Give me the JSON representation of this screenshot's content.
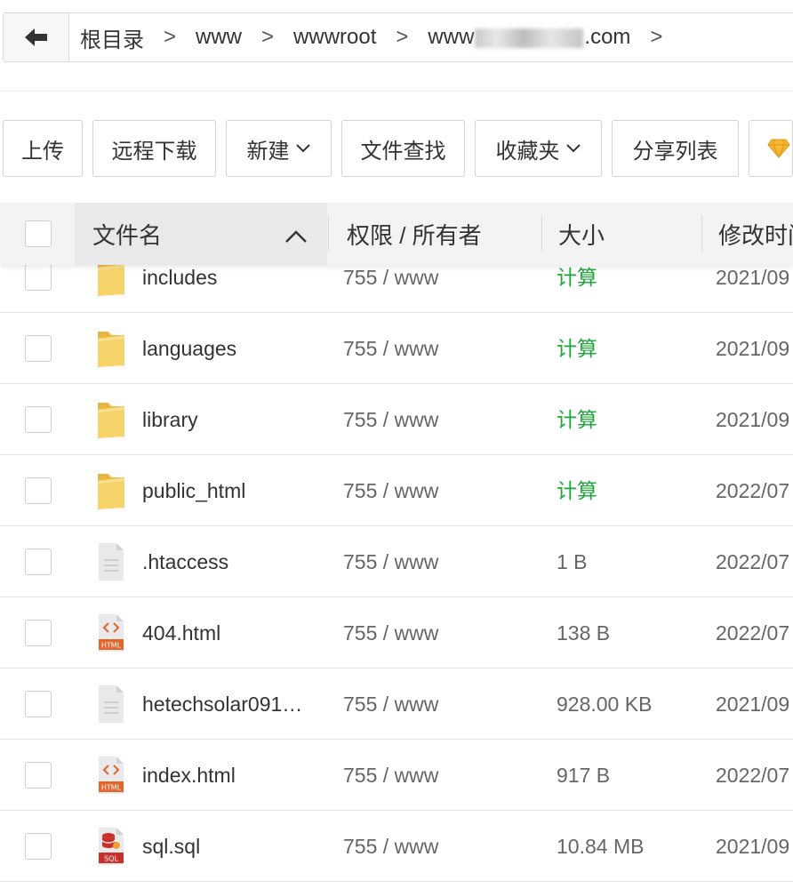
{
  "breadcrumb": {
    "items": [
      "根目录",
      "www",
      "wwwroot"
    ],
    "domain_prefix": "www",
    "domain_suffix": ".com",
    "separator": ">"
  },
  "toolbar": {
    "upload": "上传",
    "remote_download": "远程下载",
    "new": "新建",
    "file_search": "文件查找",
    "favorites": "收藏夹",
    "share_list": "分享列表"
  },
  "table": {
    "columns": {
      "name": "文件名",
      "permission": "权限 / 所有者",
      "size": "大小",
      "modified": "修改时间"
    },
    "rows": [
      {
        "type": "folder",
        "name": "includes",
        "perm": "755 / www",
        "size": "计算",
        "date": "2021/09"
      },
      {
        "type": "folder",
        "name": "languages",
        "perm": "755 / www",
        "size": "计算",
        "date": "2021/09"
      },
      {
        "type": "folder",
        "name": "library",
        "perm": "755 / www",
        "size": "计算",
        "date": "2021/09"
      },
      {
        "type": "folder",
        "name": "public_html",
        "perm": "755 / www",
        "size": "计算",
        "date": "2022/07"
      },
      {
        "type": "text",
        "name": ".htaccess",
        "perm": "755 / www",
        "size": "1 B",
        "date": "2022/07"
      },
      {
        "type": "html",
        "name": "404.html",
        "perm": "755 / www",
        "size": "138 B",
        "date": "2022/07"
      },
      {
        "type": "text",
        "name": "hetechsolar091…",
        "perm": "755 / www",
        "size": "928.00 KB",
        "date": "2021/09"
      },
      {
        "type": "html",
        "name": "index.html",
        "perm": "755 / www",
        "size": "917 B",
        "date": "2022/07"
      },
      {
        "type": "sql",
        "name": "sql.sql",
        "perm": "755 / www",
        "size": "10.84 MB",
        "date": "2021/09"
      }
    ]
  },
  "icons": {
    "html_badge": "HTML",
    "sql_badge": "SQL"
  },
  "colors": {
    "calc_green": "#20a53a",
    "folder_yellow": "#f5cf5c",
    "html_orange": "#e8632c",
    "sql_red": "#c9302c"
  }
}
